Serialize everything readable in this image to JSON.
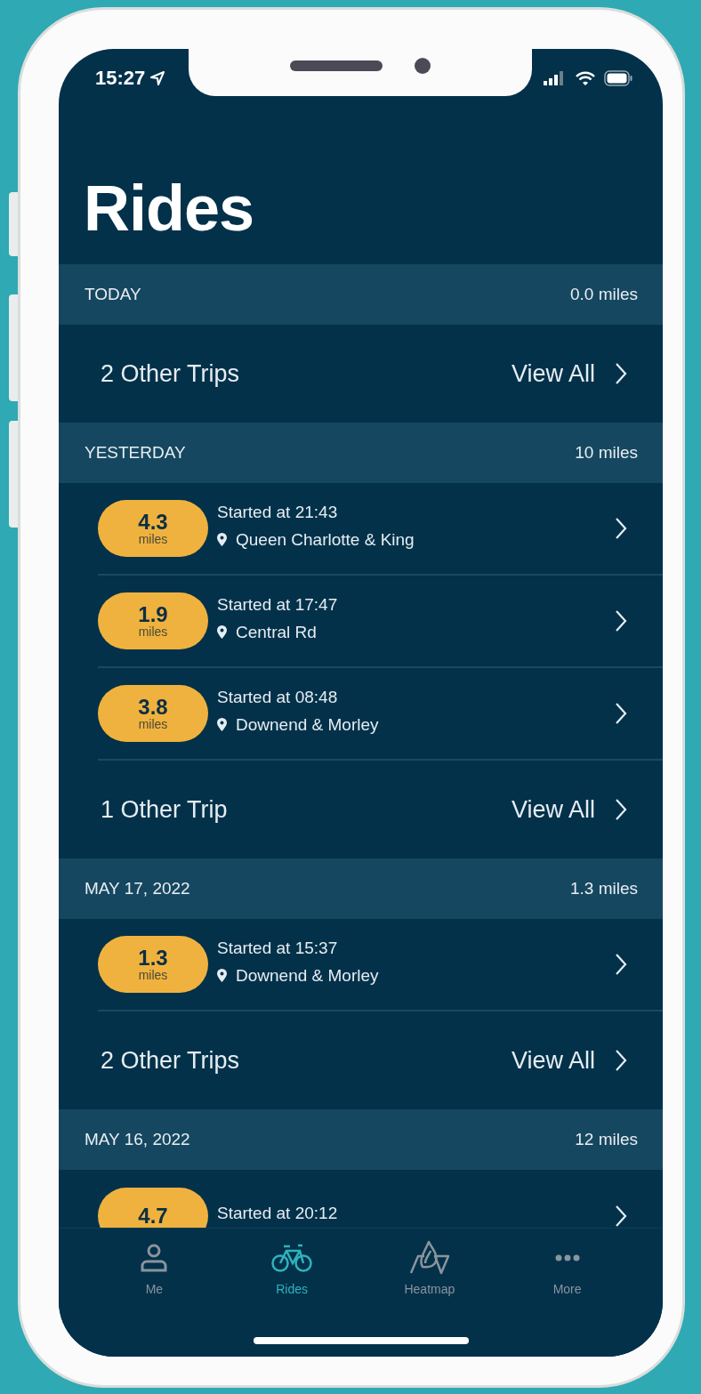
{
  "status_bar": {
    "time": "15:27"
  },
  "title": "Rides",
  "sections": [
    {
      "label": "TODAY",
      "distance": "0.0 miles",
      "items": [
        {
          "kind": "others",
          "text": "2 Other Trips",
          "action": "View All"
        }
      ]
    },
    {
      "label": "YESTERDAY",
      "distance": "10 miles",
      "items": [
        {
          "kind": "ride",
          "value": "4.3",
          "unit": "miles",
          "started": "Started at 21:43",
          "place": "Queen Charlotte & King"
        },
        {
          "kind": "ride",
          "value": "1.9",
          "unit": "miles",
          "started": "Started at 17:47",
          "place": "Central Rd"
        },
        {
          "kind": "ride",
          "value": "3.8",
          "unit": "miles",
          "started": "Started at 08:48",
          "place": "Downend & Morley"
        },
        {
          "kind": "others",
          "text": "1 Other Trip",
          "action": "View All"
        }
      ]
    },
    {
      "label": "MAY 17, 2022",
      "distance": "1.3 miles",
      "items": [
        {
          "kind": "ride",
          "value": "1.3",
          "unit": "miles",
          "started": "Started at 15:37",
          "place": "Downend & Morley"
        },
        {
          "kind": "others",
          "text": "2 Other Trips",
          "action": "View All"
        }
      ]
    },
    {
      "label": "MAY 16, 2022",
      "distance": "12 miles",
      "items": [
        {
          "kind": "ride",
          "value": "4.7",
          "started": "Started at 20:12"
        }
      ]
    }
  ],
  "tabs": [
    {
      "kind": "person",
      "label": "Me",
      "selected": false
    },
    {
      "kind": "bike",
      "label": "Rides",
      "selected": true
    },
    {
      "kind": "heatmap",
      "label": "Heatmap",
      "selected": false
    },
    {
      "kind": "more",
      "label": "More",
      "selected": false
    }
  ]
}
